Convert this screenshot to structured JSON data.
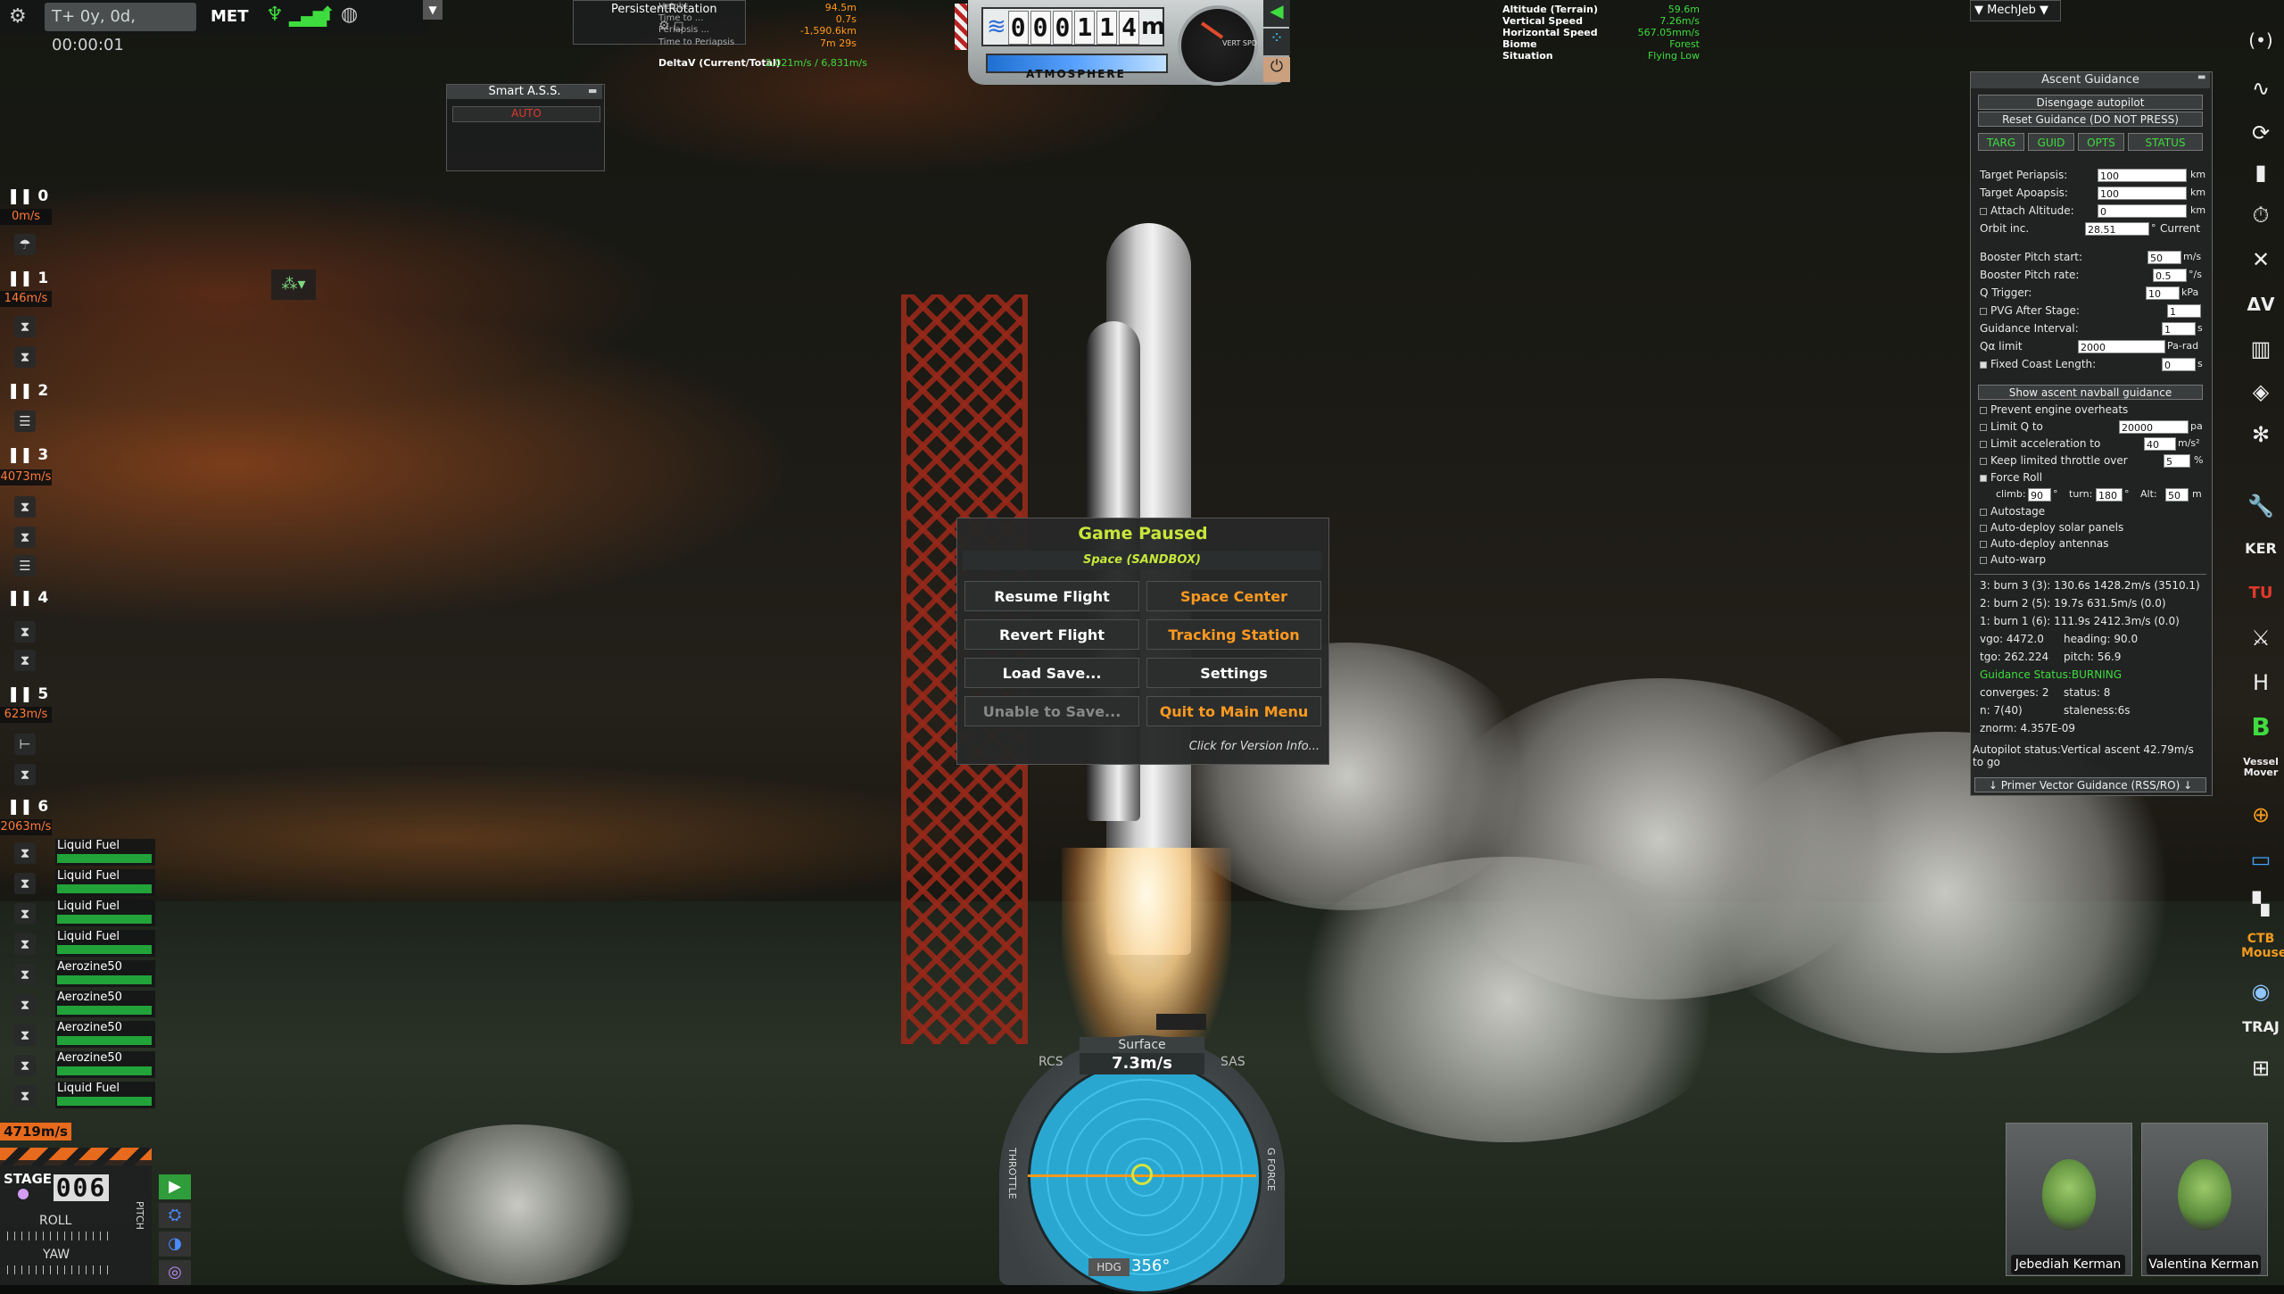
{
  "topbar": {
    "met_value": "T+ 0y, 0d, 00:00:01",
    "met_label": "MET"
  },
  "persistent_rotation": {
    "title": "PersistentRotation",
    "rows": [
      {
        "label": "Height",
        "value": "94.5m"
      },
      {
        "label": "Time to ...",
        "value": "0.7s"
      },
      {
        "label": "Periapsis ...",
        "value": "-1,590.6km"
      },
      {
        "label": "Time to Periapsis",
        "value": "7m 29s"
      },
      {
        "label": "DeltaV (Current/Total)",
        "value": "2,021m/s / 6,831m/s"
      }
    ]
  },
  "smart_ass": {
    "title": "Smart A.S.S.",
    "mode": "AUTO"
  },
  "altimeter": {
    "digits": [
      "0",
      "0",
      "0",
      "1",
      "1",
      "4"
    ],
    "unit": "m",
    "atmosphere_label": "ATMOSPHERE",
    "vert_spd_label": "VERT SPD"
  },
  "flight_info": [
    {
      "label": "Altitude (Terrain)",
      "value": "59.6m"
    },
    {
      "label": "Vertical Speed",
      "value": "7.26m/s"
    },
    {
      "label": "Horizontal Speed",
      "value": "567.05mm/s"
    },
    {
      "label": "Biome",
      "value": "Forest"
    },
    {
      "label": "Situation",
      "value": "Flying Low"
    }
  ],
  "mechjeb_label": "▼ MechJeb ▼",
  "ascent_guidance": {
    "title": "Ascent Guidance",
    "disengage": "Disengage autopilot",
    "reset": "Reset Guidance (DO NOT PRESS)",
    "tabs": [
      "TARG",
      "GUID",
      "OPTS",
      "STATUS"
    ],
    "target_periapsis_label": "Target Periapsis:",
    "target_periapsis": "100",
    "target_apoapsis_label": "Target Apoapsis:",
    "target_apoapsis": "100",
    "attach_altitude_label": "Attach Altitude:",
    "attach_altitude": "0",
    "km": "km",
    "orbit_inc_label": "Orbit inc.",
    "orbit_inc": "28.51",
    "orbit_inc_unit": "°",
    "current_label": "Current",
    "booster_pitch_start_label": "Booster Pitch start:",
    "booster_pitch_start": "50",
    "booster_pitch_start_unit": "m/s",
    "booster_pitch_rate_label": "Booster Pitch rate:",
    "booster_pitch_rate": "0.5",
    "booster_pitch_rate_unit": "°/s",
    "q_trigger_label": "Q Trigger:",
    "q_trigger": "10",
    "q_trigger_unit": "kPa",
    "pvg_after_stage_label": "PVG After Stage:",
    "pvg_after_stage": "1",
    "guidance_interval_label": "Guidance Interval:",
    "guidance_interval": "1",
    "guidance_interval_unit": "s",
    "qa_limit_label": "Qα limit",
    "qa_limit": "2000",
    "qa_limit_unit": "Pa-rad",
    "fixed_coast_label": "Fixed Coast Length:",
    "fixed_coast": "0",
    "fixed_coast_unit": "s",
    "show_navball": "Show ascent navball guidance",
    "prevent_overheats": "Prevent engine overheats",
    "limit_q_label": "Limit Q to",
    "limit_q": "20000",
    "limit_q_unit": "pa",
    "limit_accel_label": "Limit acceleration to",
    "limit_accel": "40",
    "limit_accel_unit": "m/s²",
    "keep_throttle_label": "Keep limited throttle over",
    "keep_throttle": "5",
    "keep_throttle_unit": "%",
    "force_roll_label": "Force Roll",
    "climb_label": "climb:",
    "climb": "90",
    "turn_label": "turn:",
    "turn": "180",
    "alt_label": "Alt:",
    "alt": "50",
    "alt_unit": "m",
    "deg": "°",
    "autostage": "Autostage",
    "auto_solar": "Auto-deploy solar panels",
    "auto_antennas": "Auto-deploy antennas",
    "auto_warp": "Auto-warp",
    "status_lines": [
      "3: burn 3 (3): 130.6s 1428.2m/s (3510.1)",
      "2: burn 2 (5): 19.7s 631.5m/s (0.0)",
      "1: burn 1 (6): 111.9s 2412.3m/s (0.0)"
    ],
    "vgo": "vgo: 4472.0",
    "heading": "heading: 90.0",
    "tgo": "tgo: 262.224",
    "pitch": "pitch: 56.9",
    "guidance_status": "Guidance Status:BURNING",
    "converges": "converges: 2",
    "status": "status: 8",
    "n": "n: 7(40)",
    "staleness": "staleness:6s",
    "znorm": "znorm: 4.357E-09",
    "autopilot_status": "Autopilot status:Vertical ascent 42.79m/s to go",
    "primer_vector": "↓ Primer Vector Guidance (RSS/RO) ↓"
  },
  "stages": [
    {
      "num": "0",
      "speed": "0m/s"
    },
    {
      "num": "1",
      "speed": "146m/s"
    },
    {
      "num": "2",
      "speed": ""
    },
    {
      "num": "3",
      "speed": "4073m/s"
    },
    {
      "num": "4",
      "speed": ""
    },
    {
      "num": "5",
      "speed": "623m/s"
    },
    {
      "num": "6",
      "speed": "2063m/s"
    }
  ],
  "fuel_tanks": [
    "Liquid Fuel",
    "Liquid Fuel",
    "Liquid Fuel",
    "Liquid Fuel",
    "Aerozine50",
    "Aerozine50",
    "Aerozine50",
    "Aerozine50",
    "Liquid Fuel"
  ],
  "total_dv": "4719m/s",
  "staging": {
    "stage_label": "STAGE",
    "stage_num": "006",
    "roll_label": "ROLL",
    "yaw_label": "YAW",
    "pitch_label": "PITCH"
  },
  "pause_menu": {
    "title": "Game Paused",
    "subtitle": "Space (SANDBOX)",
    "resume": "Resume Flight",
    "space_center": "Space Center",
    "revert": "Revert Flight",
    "tracking": "Tracking Station",
    "load": "Load Save...",
    "settings": "Settings",
    "unable_save": "Unable to Save...",
    "quit": "Quit to Main Menu",
    "version": "Click for Version Info..."
  },
  "navball": {
    "mode": "Surface",
    "speed": "7.3m/s",
    "rcs": "RCS",
    "sas": "SAS",
    "hdg_label": "HDG",
    "heading": "356°",
    "throttle_label": "THROTTLE",
    "gforce_label": "G FORCE"
  },
  "crew": [
    "Jebediah Kerman",
    "Valentina Kerman"
  ],
  "toolbar": [
    "(•)",
    "∿",
    "⟳",
    "▮",
    "⏱",
    "✕",
    "ΔV",
    "▥",
    "◈",
    "✻",
    "🔧",
    "KER",
    "TU",
    "⚔",
    "H",
    "B",
    "Vessel Mover",
    "⊕",
    "▭",
    "▚",
    "CTB Mouse",
    "◉",
    "TRAJ",
    "⊞"
  ],
  "colors": {
    "accent_green": "#3fdc3f",
    "accent_orange": "#ff9a1f",
    "speed_orange": "#ff7a38"
  }
}
